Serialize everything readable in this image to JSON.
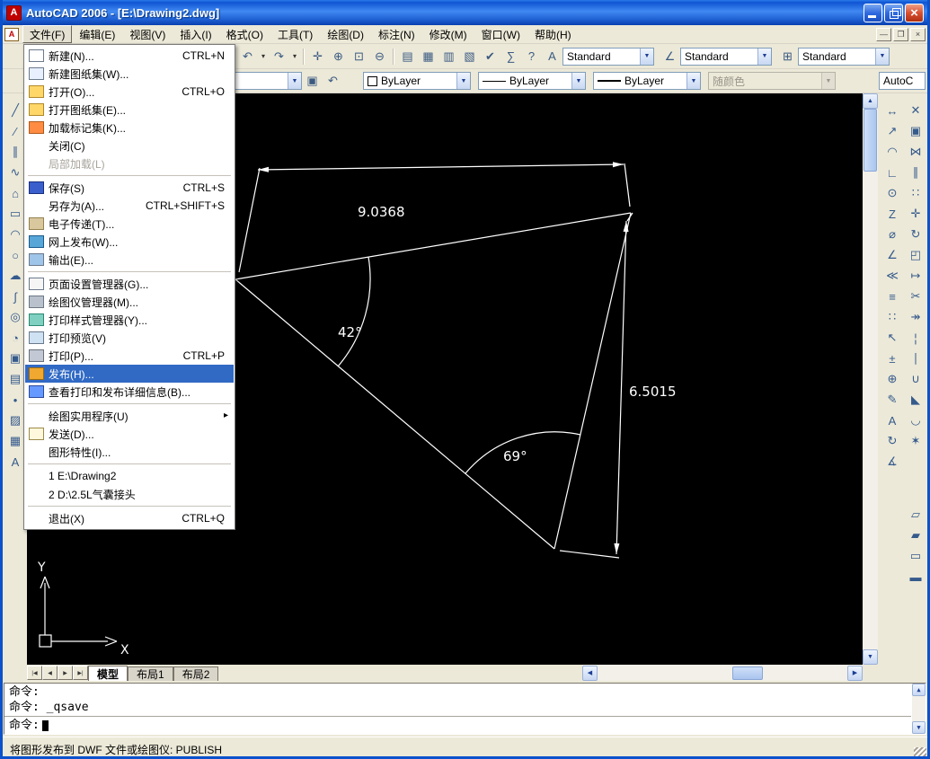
{
  "ui": {
    "combo_arrow": "▼",
    "arrow_up": "▲",
    "arrow_down": "▼",
    "arrow_left": "◀",
    "arrow_right": "▶",
    "logo_letter": "A",
    "doc_letter": "A"
  },
  "titlebar": {
    "title": "AutoCAD 2006 - [E:\\Drawing2.dwg]",
    "window_buttons": [
      {
        "name": "minimize-button"
      },
      {
        "name": "restore-button"
      },
      {
        "name": "close-button"
      }
    ]
  },
  "menubar": {
    "items": [
      {
        "label": "文件(F)",
        "name": "menu-file",
        "active": true
      },
      {
        "label": "编辑(E)",
        "name": "menu-edit"
      },
      {
        "label": "视图(V)",
        "name": "menu-view"
      },
      {
        "label": "插入(I)",
        "name": "menu-insert"
      },
      {
        "label": "格式(O)",
        "name": "menu-format"
      },
      {
        "label": "工具(T)",
        "name": "menu-tools"
      },
      {
        "label": "绘图(D)",
        "name": "menu-draw"
      },
      {
        "label": "标注(N)",
        "name": "menu-dimension"
      },
      {
        "label": "修改(M)",
        "name": "menu-modify"
      },
      {
        "label": "窗口(W)",
        "name": "menu-window"
      },
      {
        "label": "帮助(H)",
        "name": "menu-help"
      }
    ],
    "mdi_buttons": [
      {
        "name": "mdi-minimize-button",
        "glyph": "—"
      },
      {
        "name": "mdi-restore-button",
        "glyph": "❐"
      },
      {
        "name": "mdi-close-button",
        "glyph": "×"
      }
    ]
  },
  "file_menu": {
    "items": [
      {
        "label": "新建(N)...",
        "shortcut": "CTRL+N",
        "icon": "page",
        "name": "menu-item-new"
      },
      {
        "label": "新建图纸集(W)...",
        "icon": "pages",
        "name": "menu-item-new-sheet-set"
      },
      {
        "label": "打开(O)...",
        "shortcut": "CTRL+O",
        "icon": "folder",
        "name": "menu-item-open"
      },
      {
        "label": "打开图纸集(E)...",
        "icon": "folder2",
        "name": "menu-item-open-sheet-set"
      },
      {
        "label": "加载标记集(K)...",
        "icon": "markers",
        "name": "menu-item-load-markup-set"
      },
      {
        "label": "关闭(C)",
        "name": "menu-item-close"
      },
      {
        "label": "局部加载(L)",
        "disabled": true,
        "name": "menu-item-partial-load"
      },
      {
        "type": "separator"
      },
      {
        "label": "保存(S)",
        "shortcut": "CTRL+S",
        "icon": "disk",
        "name": "menu-item-save"
      },
      {
        "label": "另存为(A)...",
        "shortcut": "CTRL+SHIFT+S",
        "name": "menu-item-save-as"
      },
      {
        "label": "电子传递(T)...",
        "icon": "package",
        "name": "menu-item-etransmit"
      },
      {
        "label": "网上发布(W)...",
        "icon": "globe",
        "name": "menu-item-publish-to-web"
      },
      {
        "label": "输出(E)...",
        "icon": "export",
        "name": "menu-item-export"
      },
      {
        "type": "separator"
      },
      {
        "label": "页面设置管理器(G)...",
        "icon": "pagesetup",
        "name": "menu-item-page-setup-manager"
      },
      {
        "label": "绘图仪管理器(M)...",
        "icon": "plotter",
        "name": "menu-item-plotter-manager"
      },
      {
        "label": "打印样式管理器(Y)...",
        "icon": "styles",
        "name": "menu-item-plot-style-manager"
      },
      {
        "label": "打印预览(V)",
        "icon": "preview",
        "name": "menu-item-plot-preview"
      },
      {
        "label": "打印(P)...",
        "shortcut": "CTRL+P",
        "icon": "printer",
        "name": "menu-item-plot"
      },
      {
        "label": "发布(H)...",
        "icon": "publish",
        "selected": true,
        "name": "menu-item-publish"
      },
      {
        "label": "查看打印和发布详细信息(B)...",
        "icon": "info",
        "name": "menu-item-view-plot-details"
      },
      {
        "type": "separator"
      },
      {
        "label": "绘图实用程序(U)",
        "submenu": true,
        "name": "menu-item-drawing-utilities"
      },
      {
        "label": "发送(D)...",
        "icon": "mail",
        "name": "menu-item-send"
      },
      {
        "label": "图形特性(I)...",
        "name": "menu-item-drawing-properties"
      },
      {
        "type": "separator"
      },
      {
        "label": "1 E:\\Drawing2",
        "name": "menu-item-recent-1"
      },
      {
        "label": "2 D:\\2.5L气囊接头",
        "name": "menu-item-recent-2"
      },
      {
        "type": "separator"
      },
      {
        "label": "退出(X)",
        "shortcut": "CTRL+Q",
        "name": "menu-item-exit"
      }
    ]
  },
  "toolbars": {
    "row1": {
      "icons": [
        {
          "name": "match-properties-icon",
          "glyph": "✎"
        },
        {
          "name": "undo-icon",
          "glyph": "↶"
        },
        {
          "name": "undo-dropdown-icon",
          "glyph": "▾",
          "cls": "narrow"
        },
        {
          "name": "redo-icon",
          "glyph": "↷"
        },
        {
          "name": "redo-dropdown-icon",
          "glyph": "▾",
          "cls": "narrow"
        },
        {
          "cls": "sep"
        },
        {
          "name": "pan-icon",
          "glyph": "✛"
        },
        {
          "name": "zoom-realtime-icon",
          "glyph": "⊕"
        },
        {
          "name": "zoom-window-icon",
          "glyph": "⊡"
        },
        {
          "name": "zoom-previous-icon",
          "glyph": "⊖"
        },
        {
          "cls": "sep"
        },
        {
          "name": "properties-icon",
          "glyph": "▤"
        },
        {
          "name": "designcenter-icon",
          "glyph": "▦"
        },
        {
          "name": "tool-palettes-icon",
          "glyph": "▥"
        },
        {
          "name": "sheetset-manager-icon",
          "glyph": "▧"
        },
        {
          "name": "markup-manager-icon",
          "glyph": "✔"
        },
        {
          "name": "quickcalc-icon",
          "glyph": "∑"
        },
        {
          "name": "help-icon",
          "glyph": "?"
        }
      ],
      "style_groups": [
        {
          "icon_name": "text-style-icon",
          "glyph": "A",
          "combo_name": "text-style-combo",
          "value": "Standard"
        },
        {
          "icon_name": "dim-style-icon",
          "glyph": "∠",
          "combo_name": "dim-style-combo",
          "value": "Standard"
        },
        {
          "icon_name": "table-style-icon",
          "glyph": "⊞",
          "combo_name": "table-style-combo",
          "value": "Standard"
        }
      ]
    },
    "row2": {
      "pre_icon": {
        "name": "layer-properties-manager-icon",
        "glyph": "▤"
      },
      "layer_combo_value": "",
      "post_icons": [
        {
          "name": "make-object-layer-current-icon",
          "glyph": "▣"
        },
        {
          "name": "layer-previous-icon",
          "glyph": "↶"
        }
      ],
      "color_combo": "ByLayer",
      "linetype_combo": "ByLayer",
      "lineweight_combo": "ByLayer",
      "plotstyle_combo": "随颜色",
      "workspace_combo": "AutoC"
    }
  },
  "left_toolbar": {
    "icons": [
      {
        "name": "line-tool-icon",
        "glyph": "╱"
      },
      {
        "name": "construction-line-tool-icon",
        "glyph": "∕"
      },
      {
        "name": "multiline-tool-icon",
        "glyph": "∥"
      },
      {
        "name": "polyline-tool-icon",
        "glyph": "∿"
      },
      {
        "name": "polygon-tool-icon",
        "glyph": "⌂"
      },
      {
        "name": "rectangle-tool-icon",
        "glyph": "▭"
      },
      {
        "name": "arc-tool-icon",
        "glyph": "◠"
      },
      {
        "name": "circle-tool-icon",
        "glyph": "○"
      },
      {
        "name": "revision-cloud-tool-icon",
        "glyph": "☁"
      },
      {
        "name": "spline-tool-icon",
        "glyph": "∫"
      },
      {
        "name": "ellipse-tool-icon",
        "glyph": "◎"
      },
      {
        "name": "ellipse-arc-tool-icon",
        "glyph": "◔"
      },
      {
        "name": "insert-block-tool-icon",
        "glyph": "▣"
      },
      {
        "name": "make-block-tool-icon",
        "glyph": "▤"
      },
      {
        "name": "point-tool-icon",
        "glyph": "•"
      },
      {
        "name": "hatch-tool-icon",
        "glyph": "▨"
      },
      {
        "name": "region-tool-icon",
        "glyph": "▦"
      },
      {
        "name": "mtext-tool-icon",
        "glyph": "A"
      }
    ]
  },
  "dim_toolbar": {
    "icons": [
      {
        "name": "linear-dimension-icon",
        "glyph": "↔"
      },
      {
        "name": "aligned-dimension-icon",
        "glyph": "↗"
      },
      {
        "name": "arc-length-dimension-icon",
        "glyph": "◠"
      },
      {
        "name": "ordinate-dimension-icon",
        "glyph": "∟"
      },
      {
        "name": "radius-dimension-icon",
        "glyph": "⊙"
      },
      {
        "name": "jogged-dimension-icon",
        "glyph": "Z"
      },
      {
        "name": "diameter-dimension-icon",
        "glyph": "⌀"
      },
      {
        "name": "angular-dimension-icon",
        "glyph": "∠"
      },
      {
        "name": "quick-dimension-icon",
        "glyph": "≪"
      },
      {
        "name": "baseline-dimension-icon",
        "glyph": "≡"
      },
      {
        "name": "continue-dimension-icon",
        "glyph": "∷"
      },
      {
        "name": "quick-leader-icon",
        "glyph": "↖"
      },
      {
        "name": "tolerance-icon",
        "glyph": "±"
      },
      {
        "name": "center-mark-icon",
        "glyph": "⊕"
      },
      {
        "name": "dimension-edit-icon",
        "glyph": "✎"
      },
      {
        "name": "dimension-text-edit-icon",
        "glyph": "A"
      },
      {
        "name": "dimension-update-icon",
        "glyph": "↻"
      },
      {
        "name": "dimension-style-icon",
        "glyph": "∡"
      }
    ]
  },
  "modify_toolbar": {
    "icons": [
      {
        "name": "erase-icon",
        "glyph": "✕"
      },
      {
        "name": "copy-icon",
        "glyph": "▣"
      },
      {
        "name": "mirror-icon",
        "glyph": "⋈"
      },
      {
        "name": "offset-icon",
        "glyph": "∥"
      },
      {
        "name": "array-icon",
        "glyph": "∷"
      },
      {
        "name": "move-icon",
        "glyph": "✛"
      },
      {
        "name": "rotate-icon",
        "glyph": "↻"
      },
      {
        "name": "scale-icon",
        "glyph": "◰"
      },
      {
        "name": "stretch-icon",
        "glyph": "↦"
      },
      {
        "name": "trim-icon",
        "glyph": "✂"
      },
      {
        "name": "extend-icon",
        "glyph": "↠"
      },
      {
        "name": "break-at-point-icon",
        "glyph": "¦"
      },
      {
        "name": "break-icon",
        "glyph": "∣"
      },
      {
        "name": "join-icon",
        "glyph": "∪"
      },
      {
        "name": "chamfer-icon",
        "glyph": "◣"
      },
      {
        "name": "fillet-icon",
        "glyph": "◡"
      },
      {
        "name": "explode-icon",
        "glyph": "✶"
      },
      {
        "cls": "gap"
      },
      {
        "name": "draworder-bring-to-front-icon",
        "glyph": "▱"
      },
      {
        "name": "draworder-send-to-back-icon",
        "glyph": "▰"
      },
      {
        "name": "draworder-bring-above-icon",
        "glyph": "▭"
      },
      {
        "name": "draworder-send-under-icon",
        "glyph": "▬"
      }
    ]
  },
  "canvas": {
    "dim_top": "9.0368",
    "dim_right": "6.5015",
    "angle_left": "42°",
    "angle_bottom": "69°",
    "ucs_x": "X",
    "ucs_y": "Y"
  },
  "tabs": {
    "nav": [
      {
        "name": "tab-first-button",
        "glyph": "|◀"
      },
      {
        "name": "tab-prev-button",
        "glyph": "◀"
      },
      {
        "name": "tab-next-button",
        "glyph": "▶"
      },
      {
        "name": "tab-last-button",
        "glyph": "▶|"
      }
    ],
    "items": [
      {
        "label": "模型",
        "selected": true,
        "name": "tab-model"
      },
      {
        "label": "布局1",
        "name": "tab-layout1"
      },
      {
        "label": "布局2",
        "name": "tab-layout2"
      }
    ]
  },
  "command": {
    "history": [
      "命令:",
      "命令: _qsave"
    ],
    "prompt": "命令:"
  },
  "statusbar": {
    "message": "将图形发布到 DWF 文件或绘图仪:  PUBLISH"
  }
}
